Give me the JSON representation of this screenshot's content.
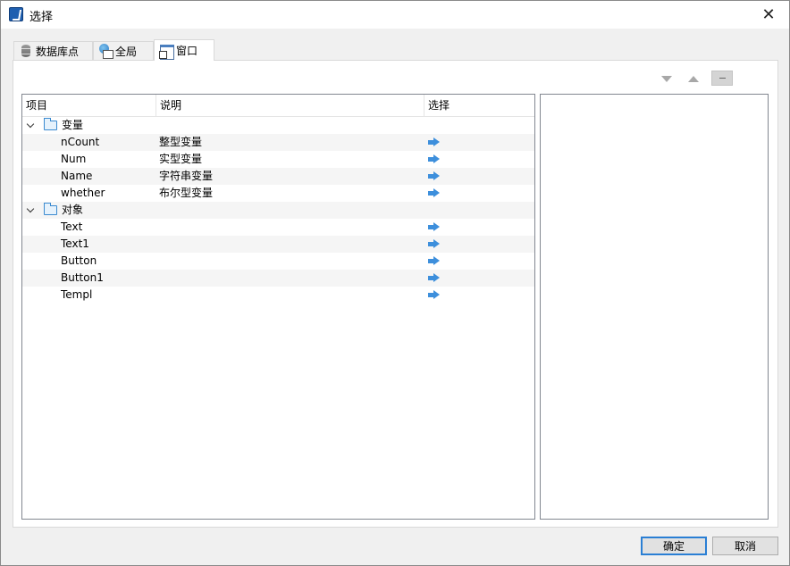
{
  "window": {
    "title": "选择",
    "close_glyph": "✕"
  },
  "tabs": [
    {
      "label": "数据库点",
      "icon": "database-icon",
      "active": false
    },
    {
      "label": "全局",
      "icon": "globe-icon",
      "active": false
    },
    {
      "label": "窗口",
      "icon": "window-icon",
      "active": true
    }
  ],
  "toolbar": {
    "move_down_icon": "triangle-down-icon",
    "move_up_icon": "triangle-up-icon",
    "remove_icon": "minus-icon"
  },
  "tree": {
    "columns": [
      "项目",
      "说明",
      "选择"
    ],
    "groups": [
      {
        "label": "变量",
        "items": [
          {
            "name": "nCount",
            "desc": "整型变量"
          },
          {
            "name": "Num",
            "desc": "实型变量"
          },
          {
            "name": "Name",
            "desc": "字符串变量"
          },
          {
            "name": "whether",
            "desc": "布尔型变量"
          }
        ]
      },
      {
        "label": "对象",
        "items": [
          {
            "name": "Text",
            "desc": ""
          },
          {
            "name": "Text1",
            "desc": ""
          },
          {
            "name": "Button",
            "desc": ""
          },
          {
            "name": "Button1",
            "desc": ""
          },
          {
            "name": "Templ",
            "desc": ""
          }
        ]
      }
    ]
  },
  "buttons": {
    "ok": "确定",
    "cancel": "取消"
  },
  "colors": {
    "accent": "#2a7fd4",
    "arrow": "#3d8fdc",
    "folder": "#3a8ad0"
  }
}
